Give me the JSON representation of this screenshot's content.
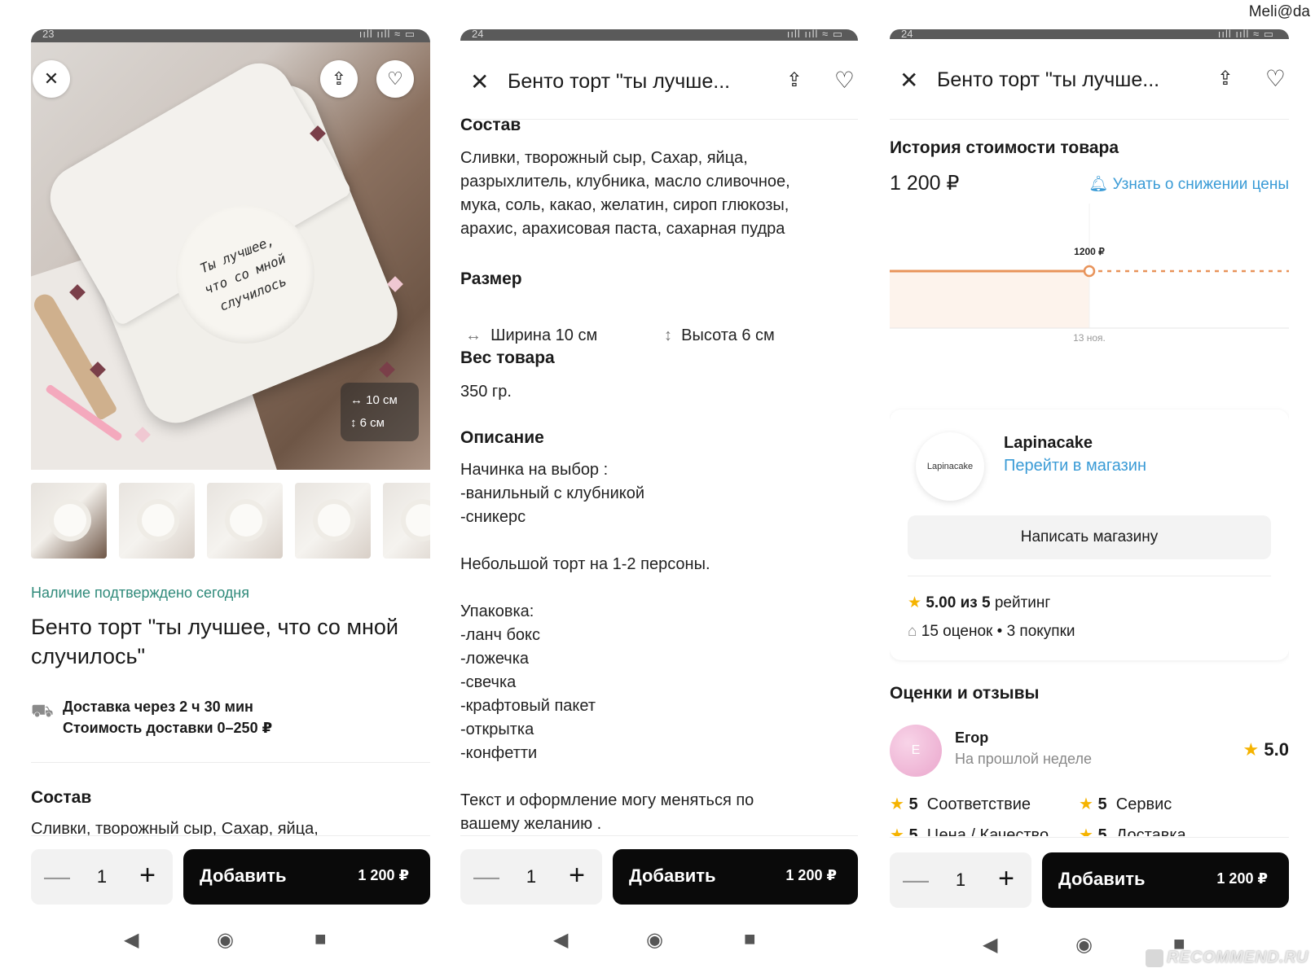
{
  "watermark_top": "Meli@da",
  "watermark_bottom": "RECOMMEND.RU",
  "status": {
    "time1": "23",
    "time2": "24",
    "time3": "24",
    "icons": "ııll ııll ≈ ▭"
  },
  "icons": {
    "close": "close-icon",
    "share": "share-icon",
    "favorite": "heart-icon",
    "truck": "truck-icon",
    "bell": "bell-icon",
    "star": "star-icon",
    "store": "store-icon",
    "width": "width-arrow-icon",
    "height": "height-arrow-icon"
  },
  "panel1": {
    "cake_text": "Ты лучшее,\nчто со мной\nслучилось",
    "dims_width": "10 см",
    "dims_height": "6 см",
    "availability": "Наличие подтверждено сегодня",
    "title": "Бенто торт \"ты лучшее, что со мной случилось\"",
    "delivery_time": "Доставка через 2 ч 30 мин",
    "delivery_cost": "Стоимость доставки 0–250 ₽",
    "composition_title": "Состав",
    "composition_preview": "Сливки, творожный сыр, Сахар, яйца,"
  },
  "panel2": {
    "header_title": "Бенто торт \"ты лучше...",
    "composition_title": "Состав",
    "composition": "Сливки, творожный сыр, Сахар, яйца,\nразрыхлитель, клубника, масло сливочное,\nмука, соль, какао, желатин, сироп глюкозы,\nарахис, арахисовая паста, сахарная пудра",
    "size_title": "Размер",
    "width_label": "Ширина 10 см",
    "height_label": "Высота 6 см",
    "weight_title": "Вес товара",
    "weight_value": "350 гр.",
    "description_title": "Описание",
    "description": "Начинка на выбор :\n-ванильный с клубникой\n-сникерс\n\nНебольшой торт на 1-2 персоны.\n\nУпаковка:\n-ланч бокс\n-ложечка\n-свечка\n-крафтовый пакет\n-открытка\n-конфетти\n\nТекст и оформление могу меняться по\nвашему желанию ."
  },
  "panel3": {
    "header_title": "Бенто торт \"ты лучше...",
    "history_title": "История стоимости товара",
    "price": "1 200 ₽",
    "notify_link": "Узнать о снижении цены",
    "chart_data": {
      "type": "line",
      "x": [
        "13 ноя."
      ],
      "series": [
        {
          "values": [
            1200
          ]
        }
      ],
      "point_label": "1200 ₽",
      "xlabel": "",
      "ylabel": ""
    },
    "store_logo_text": "Lapinacake",
    "store_name": "Lapinacake",
    "store_link": "Перейти в магазин",
    "write_store": "Написать магазину",
    "rating_value": "5.00 из 5",
    "rating_word": "рейтинг",
    "ratings_count": "15 оценок",
    "dot": "•",
    "purchases": "3 покупки",
    "reviews_title": "Оценки и отзывы",
    "reviewer_initial": "Е",
    "reviewer_name": "Егор",
    "review_time": "На прошлой неделе",
    "review_score": "5.0",
    "criteria": [
      {
        "score": "5",
        "label": "Соответствие"
      },
      {
        "score": "5",
        "label": "Сервис"
      },
      {
        "score": "5",
        "label": "Цена / Качество"
      },
      {
        "score": "5",
        "label": "Доставка"
      }
    ]
  },
  "cart": {
    "minus": "—",
    "quantity": "1",
    "plus": "+",
    "add_label": "Добавить",
    "price": "1 200 ₽"
  },
  "navbar": {
    "back": "◀",
    "home": "◉",
    "recent": "■"
  }
}
